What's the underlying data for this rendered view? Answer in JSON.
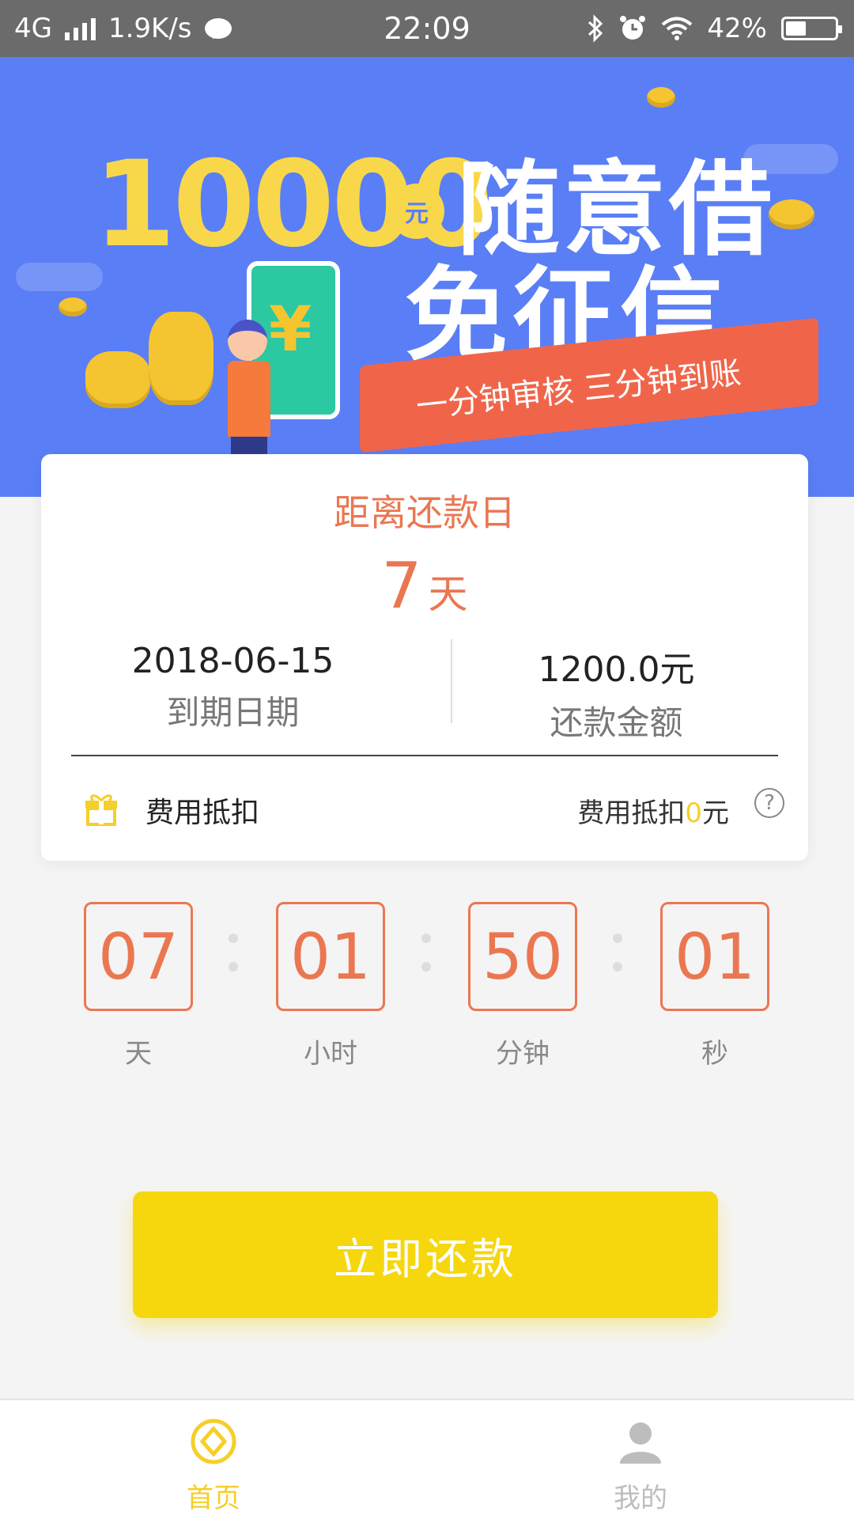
{
  "status_bar": {
    "network": "4G",
    "speed": "1.9K/s",
    "time": "22:09",
    "battery": "42%",
    "battery_level": 0.42
  },
  "banner": {
    "amount": "10000",
    "currency_badge": "元",
    "headline_line1": "随意借",
    "headline_line2": "免征信",
    "ribbon_text": "一分钟审核 三分钟到账",
    "phone_symbol": "¥"
  },
  "repayment": {
    "title": "距离还款日",
    "days_number": "7",
    "days_unit": "天",
    "due_date": "2018-06-15",
    "due_date_label": "到期日期",
    "amount": "1200.0元",
    "amount_label": "还款金额",
    "deduct_label": "费用抵扣",
    "deduct_prefix": "费用抵扣",
    "deduct_value": "0",
    "deduct_suffix": "元",
    "help_symbol": "?"
  },
  "countdown": {
    "days": "07",
    "days_label": "天",
    "hours": "01",
    "hours_label": "小时",
    "minutes": "50",
    "minutes_label": "分钟",
    "seconds": "01",
    "seconds_label": "秒"
  },
  "actions": {
    "pay_label": "立即还款"
  },
  "tabbar": {
    "home_label": "首页",
    "home_icon": "home-coin-icon",
    "mine_label": "我的",
    "mine_icon": "user-icon",
    "active_color": "#f5cf2a",
    "inactive_color": "#bdbdbd"
  },
  "colors": {
    "accent": "#ea7752",
    "primary_button": "#f6d70d",
    "banner_bg": "#5a7ef5"
  }
}
